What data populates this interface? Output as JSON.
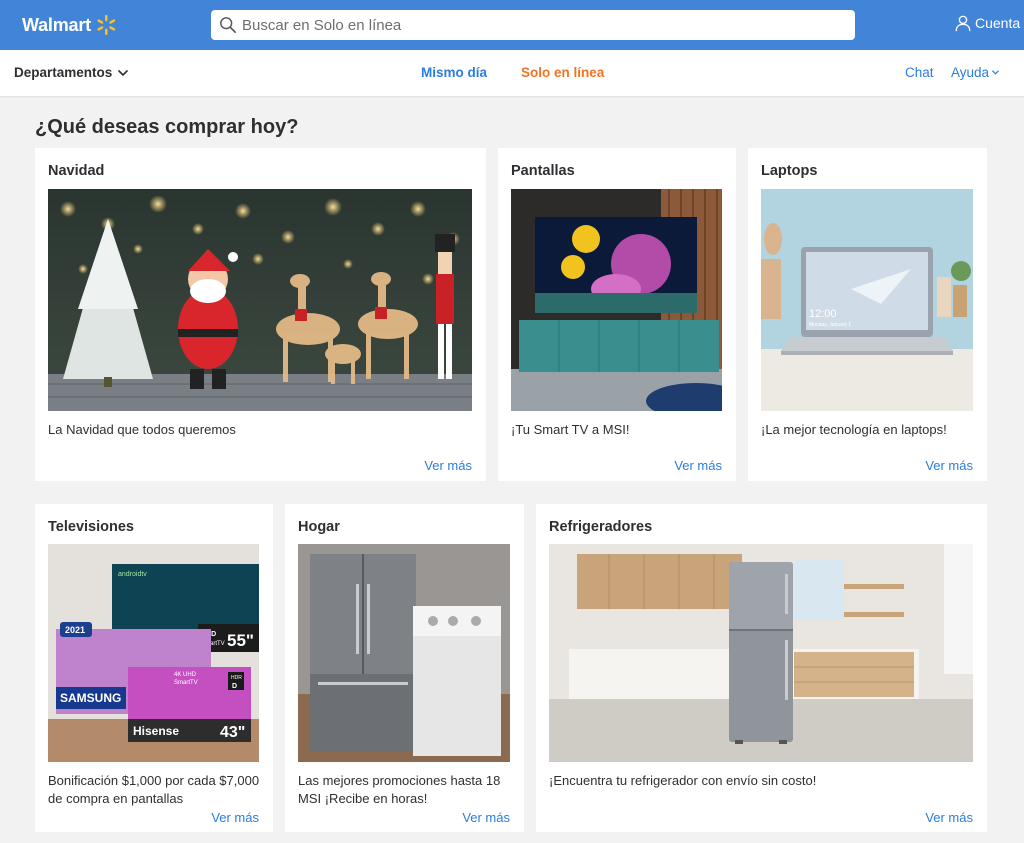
{
  "header": {
    "logo_text": "Walmart",
    "search_placeholder": "Buscar en Solo en línea",
    "account_label": "Cuenta",
    "colors": {
      "header_bg": "#4285d8",
      "spark": "#ffc220"
    }
  },
  "nav": {
    "departments_label": "Departamentos",
    "mismo_dia_label": "Mismo día",
    "solo_en_linea_label": "Solo en línea",
    "chat_label": "Chat",
    "ayuda_label": "Ayuda",
    "colors": {
      "mismo_dia": "#2a7de1",
      "solo_en_linea": "#f47321"
    }
  },
  "page_title": "¿Qué deseas comprar hoy?",
  "cards": [
    {
      "title": "Navidad",
      "description": "La Navidad que todos queremos",
      "link": "Ver más"
    },
    {
      "title": "Pantallas",
      "description": "¡Tu Smart TV a MSI!",
      "link": "Ver más"
    },
    {
      "title": "Laptops",
      "description": "¡La mejor tecnología en laptops!",
      "link": "Ver más"
    },
    {
      "title": "Televisiones",
      "description": "Bonificación $1,000 por cada $7,000 de compra en pantallas",
      "link": "Ver más"
    },
    {
      "title": "Hogar",
      "description": "Las mejores promociones hasta 18 MSI ¡Recibe en horas!",
      "link": "Ver más"
    },
    {
      "title": "Refrigeradores",
      "description": "¡Encuentra tu refrigerador con envío sin costo!",
      "link": "Ver más"
    }
  ],
  "tv_promo": {
    "year_badge": "2021",
    "samsung_brand": "SAMSUNG",
    "hisense_brand": "Hisense",
    "size_55": "55\"",
    "size_43": "43\"",
    "android_tv": "androidtv",
    "uhd_label": "UHD",
    "smart_tv": "SmartTV",
    "hisense_4k": "4K UHD",
    "hisense_smarttv": "SmartTV",
    "hdr_label": "HDR",
    "dolby_label": "D"
  },
  "laptop_screen": {
    "time": "12:00",
    "date": "Monday, January 1"
  }
}
